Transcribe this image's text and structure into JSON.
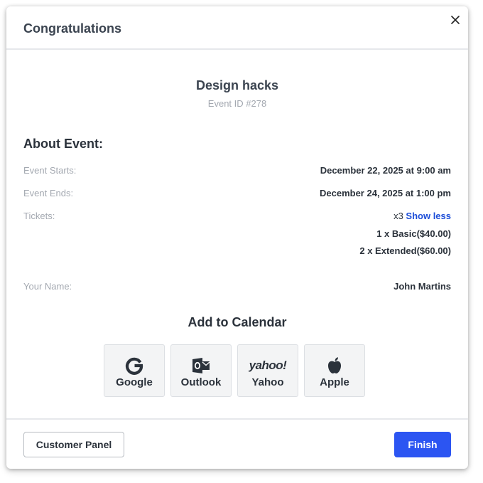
{
  "header": {
    "title": "Congratulations",
    "close_icon": "close-icon"
  },
  "event": {
    "name": "Design hacks",
    "id_label": "Event ID #278"
  },
  "about": {
    "title": "About Event:",
    "starts_label": "Event Starts:",
    "starts_value": "December 22, 2025 at 9:00 am",
    "ends_label": "Event Ends:",
    "ends_value": "December 24, 2025 at 1:00 pm",
    "tickets_label": "Tickets:",
    "tickets_count": "x3",
    "tickets_toggle": "Show less",
    "ticket_lines": [
      "1 x Basic($40.00)",
      "2 x Extended($60.00)"
    ],
    "name_label": "Your Name:",
    "name_value": "John Martins"
  },
  "calendar": {
    "title": "Add to Calendar",
    "options": [
      {
        "label": "Google",
        "icon": "google-icon"
      },
      {
        "label": "Outlook",
        "icon": "outlook-icon"
      },
      {
        "label": "Yahoo",
        "icon": "yahoo-icon",
        "icon_text": "yahoo!"
      },
      {
        "label": "Apple",
        "icon": "apple-icon"
      }
    ]
  },
  "footer": {
    "secondary_label": "Customer Panel",
    "primary_label": "Finish"
  },
  "colors": {
    "primary": "#2c55f2",
    "link": "#1d4ed8",
    "muted": "#a3a8b0",
    "text": "#2b323b"
  }
}
